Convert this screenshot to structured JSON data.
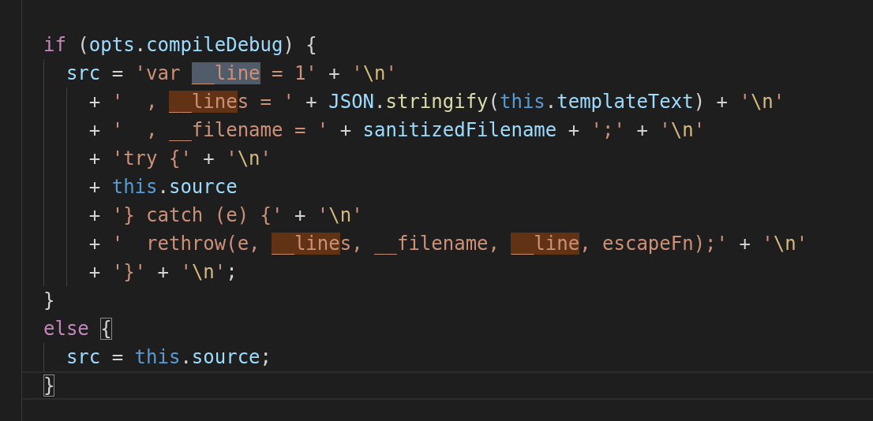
{
  "editor": {
    "lines": [
      {
        "tokens": [
          {
            "t": "if",
            "kind": "kw"
          },
          {
            "t": " (",
            "kind": "punc"
          },
          {
            "t": "opts",
            "kind": "var"
          },
          {
            "t": ".",
            "kind": "punc"
          },
          {
            "t": "compileDebug",
            "kind": "var"
          },
          {
            "t": ") {",
            "kind": "punc"
          }
        ]
      },
      {
        "tokens": [
          {
            "t": "  src",
            "kind": "var"
          },
          {
            "t": " = ",
            "kind": "punc"
          },
          {
            "t": "'var ",
            "kind": "str"
          },
          {
            "t": "__line",
            "kind": "str",
            "selected": true
          },
          {
            "t": " = 1'",
            "kind": "str"
          },
          {
            "t": " + ",
            "kind": "punc"
          },
          {
            "t": "'",
            "kind": "str"
          },
          {
            "t": "\\n",
            "kind": "esc"
          },
          {
            "t": "'",
            "kind": "str"
          }
        ]
      },
      {
        "tokens": [
          {
            "t": "    + ",
            "kind": "punc"
          },
          {
            "t": "'  , ",
            "kind": "str"
          },
          {
            "t": "__line",
            "kind": "str",
            "match": true
          },
          {
            "t": "s = '",
            "kind": "str"
          },
          {
            "t": " + ",
            "kind": "punc"
          },
          {
            "t": "JSON",
            "kind": "var"
          },
          {
            "t": ".",
            "kind": "punc"
          },
          {
            "t": "stringify",
            "kind": "fn"
          },
          {
            "t": "(",
            "kind": "punc"
          },
          {
            "t": "this",
            "kind": "this"
          },
          {
            "t": ".",
            "kind": "punc"
          },
          {
            "t": "templateText",
            "kind": "var"
          },
          {
            "t": ") + ",
            "kind": "punc"
          },
          {
            "t": "'",
            "kind": "str"
          },
          {
            "t": "\\n",
            "kind": "esc"
          },
          {
            "t": "'",
            "kind": "str"
          }
        ]
      },
      {
        "tokens": [
          {
            "t": "    + ",
            "kind": "punc"
          },
          {
            "t": "'  , __filename = '",
            "kind": "str"
          },
          {
            "t": " + ",
            "kind": "punc"
          },
          {
            "t": "sanitizedFilename",
            "kind": "var"
          },
          {
            "t": " + ",
            "kind": "punc"
          },
          {
            "t": "';'",
            "kind": "str"
          },
          {
            "t": " + ",
            "kind": "punc"
          },
          {
            "t": "'",
            "kind": "str"
          },
          {
            "t": "\\n",
            "kind": "esc"
          },
          {
            "t": "'",
            "kind": "str"
          }
        ]
      },
      {
        "tokens": [
          {
            "t": "    + ",
            "kind": "punc"
          },
          {
            "t": "'try {'",
            "kind": "str"
          },
          {
            "t": " + ",
            "kind": "punc"
          },
          {
            "t": "'",
            "kind": "str"
          },
          {
            "t": "\\n",
            "kind": "esc"
          },
          {
            "t": "'",
            "kind": "str"
          }
        ]
      },
      {
        "tokens": [
          {
            "t": "    + ",
            "kind": "punc"
          },
          {
            "t": "this",
            "kind": "this"
          },
          {
            "t": ".",
            "kind": "punc"
          },
          {
            "t": "source",
            "kind": "var"
          }
        ]
      },
      {
        "tokens": [
          {
            "t": "    + ",
            "kind": "punc"
          },
          {
            "t": "'} catch (e) {'",
            "kind": "str"
          },
          {
            "t": " + ",
            "kind": "punc"
          },
          {
            "t": "'",
            "kind": "str"
          },
          {
            "t": "\\n",
            "kind": "esc"
          },
          {
            "t": "'",
            "kind": "str"
          }
        ]
      },
      {
        "tokens": [
          {
            "t": "    + ",
            "kind": "punc"
          },
          {
            "t": "'  rethrow(e, ",
            "kind": "str"
          },
          {
            "t": "__line",
            "kind": "str",
            "match": true
          },
          {
            "t": "s, __filename, ",
            "kind": "str"
          },
          {
            "t": "__line",
            "kind": "str",
            "match": true
          },
          {
            "t": ", escapeFn);'",
            "kind": "str"
          },
          {
            "t": " + ",
            "kind": "punc"
          },
          {
            "t": "'",
            "kind": "str"
          },
          {
            "t": "\\n",
            "kind": "esc"
          },
          {
            "t": "'",
            "kind": "str"
          }
        ]
      },
      {
        "tokens": [
          {
            "t": "    + ",
            "kind": "punc"
          },
          {
            "t": "'}'",
            "kind": "str"
          },
          {
            "t": " + ",
            "kind": "punc"
          },
          {
            "t": "'",
            "kind": "str"
          },
          {
            "t": "\\n",
            "kind": "esc"
          },
          {
            "t": "'",
            "kind": "str"
          },
          {
            "t": ";",
            "kind": "punc"
          }
        ]
      },
      {
        "tokens": [
          {
            "t": "}",
            "kind": "punc"
          }
        ]
      },
      {
        "tokens": [
          {
            "t": "else ",
            "kind": "kw"
          },
          {
            "t": "{",
            "kind": "punc",
            "bracket_match": true
          }
        ]
      },
      {
        "tokens": [
          {
            "t": "  src",
            "kind": "var"
          },
          {
            "t": " = ",
            "kind": "punc"
          },
          {
            "t": "this",
            "kind": "this"
          },
          {
            "t": ".",
            "kind": "punc"
          },
          {
            "t": "source",
            "kind": "var"
          },
          {
            "t": ";",
            "kind": "punc"
          }
        ]
      },
      {
        "current": true,
        "tokens": [
          {
            "t": "}",
            "kind": "punc",
            "bracket_match": true
          }
        ]
      }
    ]
  }
}
